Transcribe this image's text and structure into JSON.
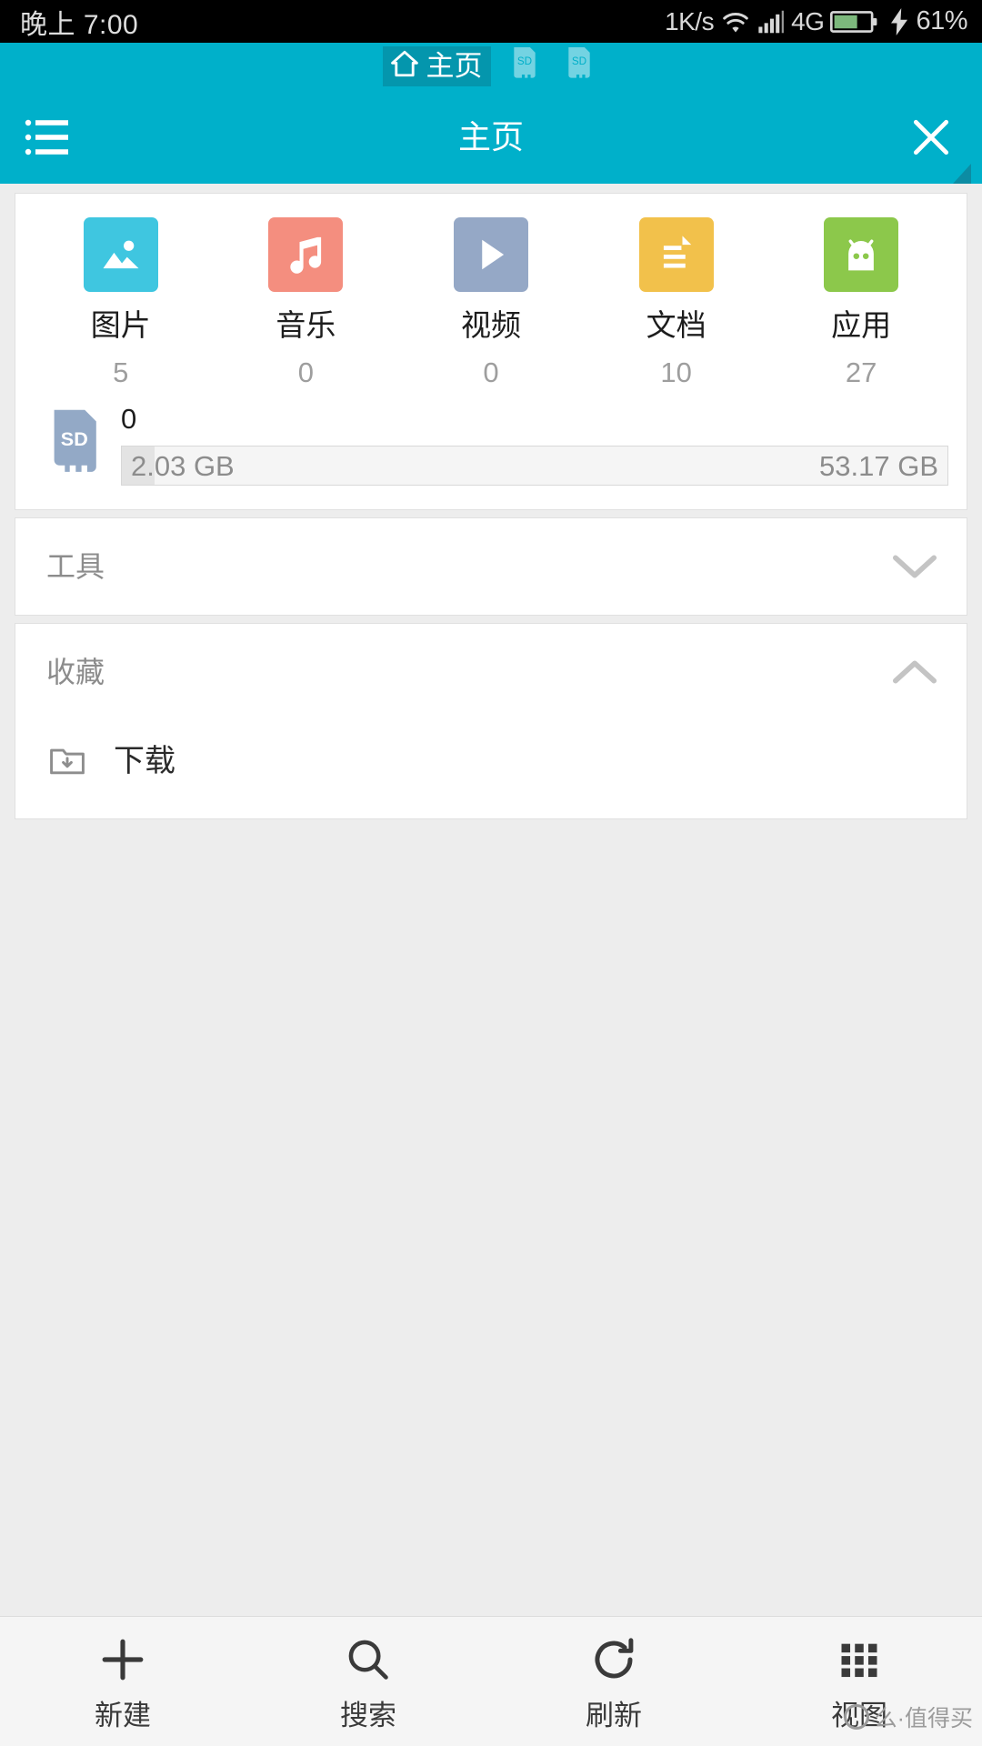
{
  "status_bar": {
    "time": "晚上 7:00",
    "network_speed": "1K/s",
    "wifi_icon": "wifi-icon",
    "signal_icon": "signal-bars-icon",
    "network_type": "4G",
    "battery_icon": "battery-charging-icon",
    "battery_percent": "61%",
    "background": "#000000",
    "text_color": "#d8d8d8",
    "battery_fill": "#7cb87c"
  },
  "tabs": {
    "items": [
      {
        "label": "主页",
        "icon": "home-icon",
        "active": true
      },
      {
        "label": "",
        "icon": "sd-card-icon",
        "active": false
      },
      {
        "label": "",
        "icon": "sd-card-icon",
        "active": false
      }
    ],
    "active_background": "#0496ad",
    "background": "#00b0ca"
  },
  "header": {
    "title": "主页",
    "menu_icon": "list-menu-icon",
    "close_icon": "close-icon",
    "corner_marker_icon": "resize-corner-icon",
    "accent": "#00b0ca"
  },
  "categories": [
    {
      "label": "图片",
      "count": "5",
      "icon": "image-icon",
      "color": "#3fc6e0"
    },
    {
      "label": "音乐",
      "count": "0",
      "icon": "music-icon",
      "color": "#f48e7f"
    },
    {
      "label": "视频",
      "count": "0",
      "icon": "video-icon",
      "color": "#95a8c6"
    },
    {
      "label": "文档",
      "count": "10",
      "icon": "document-icon",
      "color": "#f2c14b"
    },
    {
      "label": "应用",
      "count": "27",
      "icon": "android-icon",
      "color": "#8cc84b"
    }
  ],
  "storage": {
    "icon": "sd-card-icon",
    "name": "0",
    "used": "2.03 GB",
    "total": "53.17 GB",
    "fill_percent": 4,
    "icon_color": "#93a9c6"
  },
  "sections": [
    {
      "title": "工具",
      "expanded": false,
      "chevron": "chevron-down-icon"
    },
    {
      "title": "收藏",
      "expanded": true,
      "chevron": "chevron-up-icon"
    }
  ],
  "favorites": [
    {
      "label": "下载",
      "icon": "folder-download-icon"
    }
  ],
  "bottom_bar": [
    {
      "label": "新建",
      "icon": "plus-icon"
    },
    {
      "label": "搜索",
      "icon": "search-icon"
    },
    {
      "label": "刷新",
      "icon": "refresh-icon"
    },
    {
      "label": "视图",
      "icon": "grid-view-icon"
    }
  ],
  "watermark": {
    "text": "么·值得买"
  }
}
